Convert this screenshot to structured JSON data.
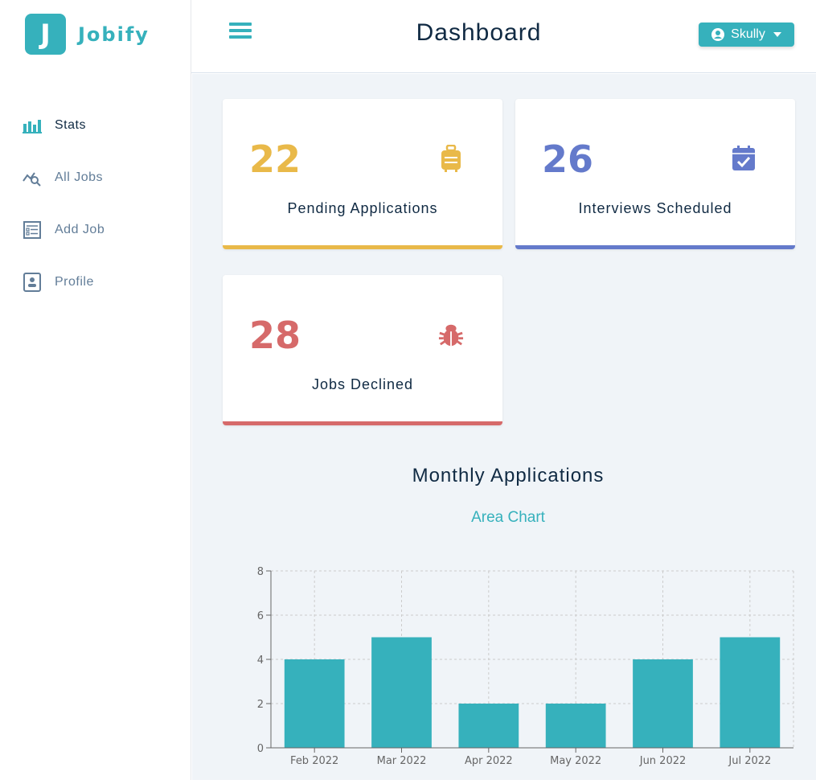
{
  "app": {
    "logo_letter": "J",
    "name": "Jobify"
  },
  "header": {
    "title": "Dashboard",
    "user_name": "Skully"
  },
  "sidebar": {
    "items": [
      {
        "label": "Stats",
        "icon": "bar-chart-icon",
        "active": true
      },
      {
        "label": "All Jobs",
        "icon": "search-chart-icon",
        "active": false
      },
      {
        "label": "Add Job",
        "icon": "form-icon",
        "active": false
      },
      {
        "label": "Profile",
        "icon": "id-card-icon",
        "active": false
      }
    ]
  },
  "stats": [
    {
      "count": "22",
      "label": "Pending Applications",
      "icon": "suitcase-icon",
      "color": "#e9b949"
    },
    {
      "count": "26",
      "label": "Interviews Scheduled",
      "icon": "calendar-check-icon",
      "color": "#647acb"
    },
    {
      "count": "28",
      "label": "Jobs Declined",
      "icon": "bug-icon",
      "color": "#d66a6a"
    }
  ],
  "chart_section": {
    "title": "Monthly Applications",
    "toggle_label": "Area Chart"
  },
  "colors": {
    "primary": "#36b1bc",
    "text_dark": "#102a43",
    "text_muted": "#627d98",
    "background": "#f0f4f8"
  },
  "chart_data": {
    "type": "bar",
    "categories": [
      "Feb 2022",
      "Mar 2022",
      "Apr 2022",
      "May 2022",
      "Jun 2022",
      "Jul 2022"
    ],
    "values": [
      4,
      5,
      2,
      2,
      4,
      5
    ],
    "yticks": [
      0,
      2,
      4,
      6,
      8
    ],
    "ylim": [
      0,
      8
    ],
    "grid": true,
    "bar_color": "#36b1bc"
  }
}
